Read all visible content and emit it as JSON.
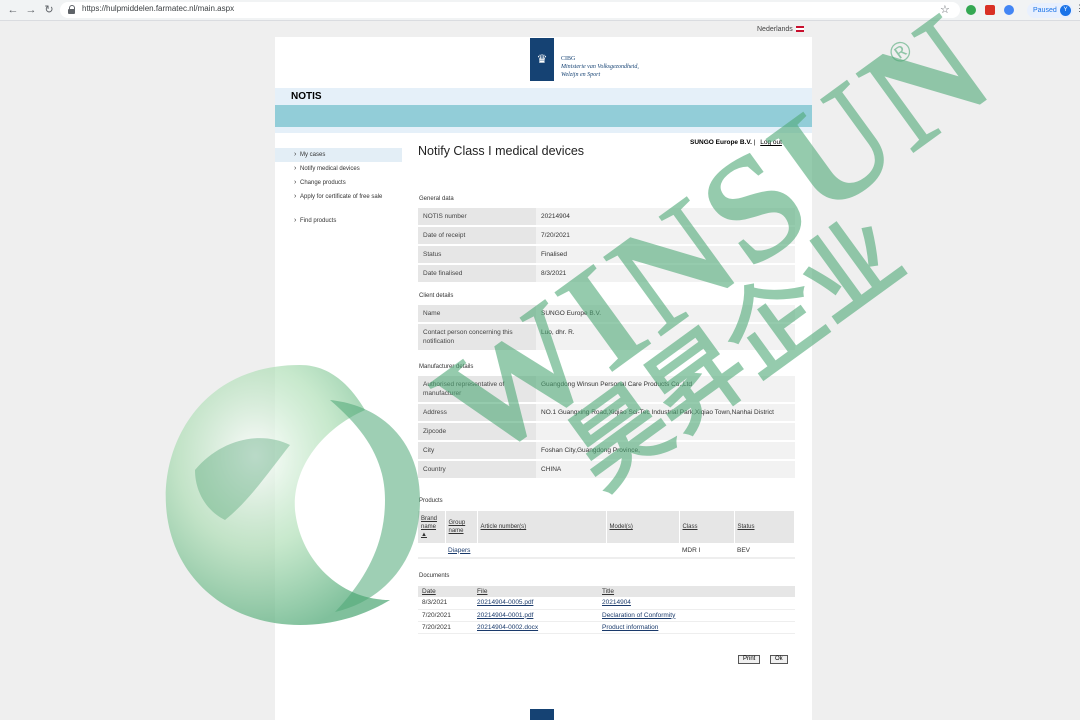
{
  "browser": {
    "url": "https://hulpmiddelen.farmatec.nl/main.aspx",
    "back_icon": "←",
    "forward_icon": "→",
    "reload_icon": "↻",
    "star_icon": "☆",
    "profile_status": "Paused",
    "profile_initial": "Y",
    "menu_icon": "⋮"
  },
  "language": "Nederlands",
  "logo": {
    "line1": "CIBG",
    "line2": "Ministerie van Volksgezondheid,",
    "line3": "Welzijn en Sport"
  },
  "app_title": "NOTIS",
  "sidebar": {
    "items": [
      {
        "label": "My cases"
      },
      {
        "label": "Notify medical devices"
      },
      {
        "label": "Change products"
      },
      {
        "label": "Apply for certificate of free sale"
      },
      {
        "label": "Find products"
      }
    ]
  },
  "user": {
    "company": "SUNGO Europe B.V.",
    "separator": "|",
    "logout": "Log out"
  },
  "page_title": "Notify Class I medical devices",
  "general": {
    "heading": "General data",
    "rows": [
      {
        "k": "NOTIS number",
        "v": "20214904"
      },
      {
        "k": "Date of receipt",
        "v": "7/20/2021"
      },
      {
        "k": "Status",
        "v": "Finalised"
      },
      {
        "k": "Date finalised",
        "v": "8/3/2021"
      }
    ]
  },
  "client": {
    "heading": "Client details",
    "rows": [
      {
        "k": "Name",
        "v": "SUNGO Europe B.V."
      },
      {
        "k": "Contact person concerning this notification",
        "v": "Luo, dhr. R."
      }
    ]
  },
  "manufacturer": {
    "heading": "Manufacturer details",
    "rows": [
      {
        "k": "Authorised representative of manufacturer",
        "v": "Guangdong Winsun Personal Care Products Co.,Ltd"
      },
      {
        "k": "Address",
        "v": "NO.1 Guangxing Road,Xiqiao Sci-Tec Industrial Park,Xiqiao Town,Nanhai District"
      },
      {
        "k": "Zipcode",
        "v": ""
      },
      {
        "k": "City",
        "v": "Foshan City,Guangdong Province,"
      },
      {
        "k": "Country",
        "v": "CHINA"
      }
    ]
  },
  "products": {
    "heading": "Products",
    "columns": [
      "Brand name ▲",
      "Group name",
      "Article number(s)",
      "Model(s)",
      "Class",
      "Status"
    ],
    "rows": [
      {
        "brand": "",
        "group": "Diapers",
        "article": "",
        "model": "",
        "class": "MDR I",
        "status": "BEV"
      }
    ]
  },
  "documents": {
    "heading": "Documents",
    "columns": [
      "Date",
      "File",
      "Title"
    ],
    "rows": [
      {
        "date": "8/3/2021",
        "file": "20214904-0005.pdf",
        "title": "20214904"
      },
      {
        "date": "7/20/2021",
        "file": "20214904-0001.pdf",
        "title": "Declaration of Conformity"
      },
      {
        "date": "7/20/2021",
        "file": "20214904-0002.docx",
        "title": "Product information"
      }
    ]
  },
  "buttons": {
    "print": "Print",
    "ok": "Ok"
  },
  "watermark": {
    "brand": "WINSUN",
    "registered": "®",
    "chinese": "昊昇企业",
    "color": "#4fa876"
  }
}
